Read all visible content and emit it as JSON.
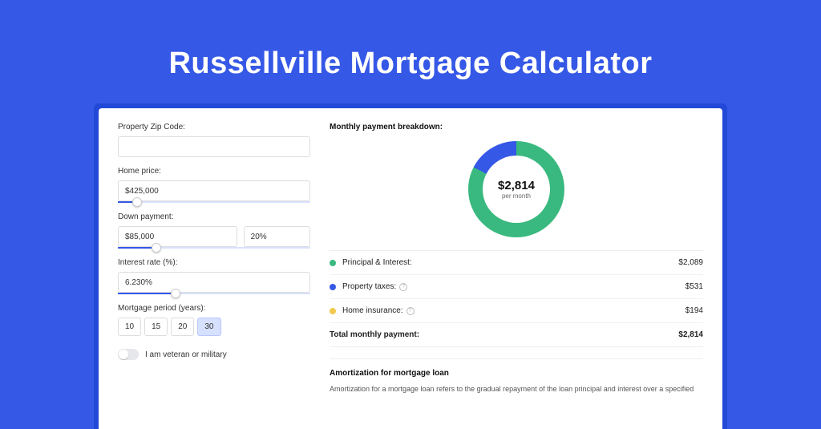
{
  "page": {
    "title": "Russellville Mortgage Calculator"
  },
  "form": {
    "zip": {
      "label": "Property Zip Code:",
      "value": ""
    },
    "homePrice": {
      "label": "Home price:",
      "value": "$425,000",
      "sliderPct": 10
    },
    "downPayment": {
      "label": "Down payment:",
      "amount": "$85,000",
      "percent": "20%",
      "sliderPct": 20
    },
    "interestRate": {
      "label": "Interest rate (%):",
      "value": "6.230%",
      "sliderPct": 30
    },
    "period": {
      "label": "Mortgage period (years):",
      "options": [
        "10",
        "15",
        "20",
        "30"
      ],
      "selected": "30"
    },
    "veteran": {
      "label": "I am veteran or military",
      "on": false
    }
  },
  "breakdown": {
    "title": "Monthly payment breakdown:",
    "donut": {
      "amount": "$2,814",
      "sub": "per month"
    },
    "rows": [
      {
        "dot": "#39b97f",
        "label": "Principal & Interest:",
        "info": false,
        "value": "$2,089"
      },
      {
        "dot": "#3558e6",
        "label": "Property taxes:",
        "info": true,
        "value": "$531"
      },
      {
        "dot": "#f2c94c",
        "label": "Home insurance:",
        "info": true,
        "value": "$194"
      }
    ],
    "total": {
      "label": "Total monthly payment:",
      "value": "$2,814"
    }
  },
  "amort": {
    "title": "Amortization for mortgage loan",
    "text": "Amortization for a mortgage loan refers to the gradual repayment of the loan principal and interest over a specified"
  },
  "chart_data": {
    "type": "pie",
    "title": "Monthly payment breakdown",
    "series": [
      {
        "name": "Principal & Interest",
        "value": 2089,
        "color": "#39b97f"
      },
      {
        "name": "Property taxes",
        "value": 531,
        "color": "#3558e6"
      },
      {
        "name": "Home insurance",
        "value": 194,
        "color": "#f2c94c"
      }
    ],
    "total": 2814,
    "center_label": "$2,814 per month"
  }
}
